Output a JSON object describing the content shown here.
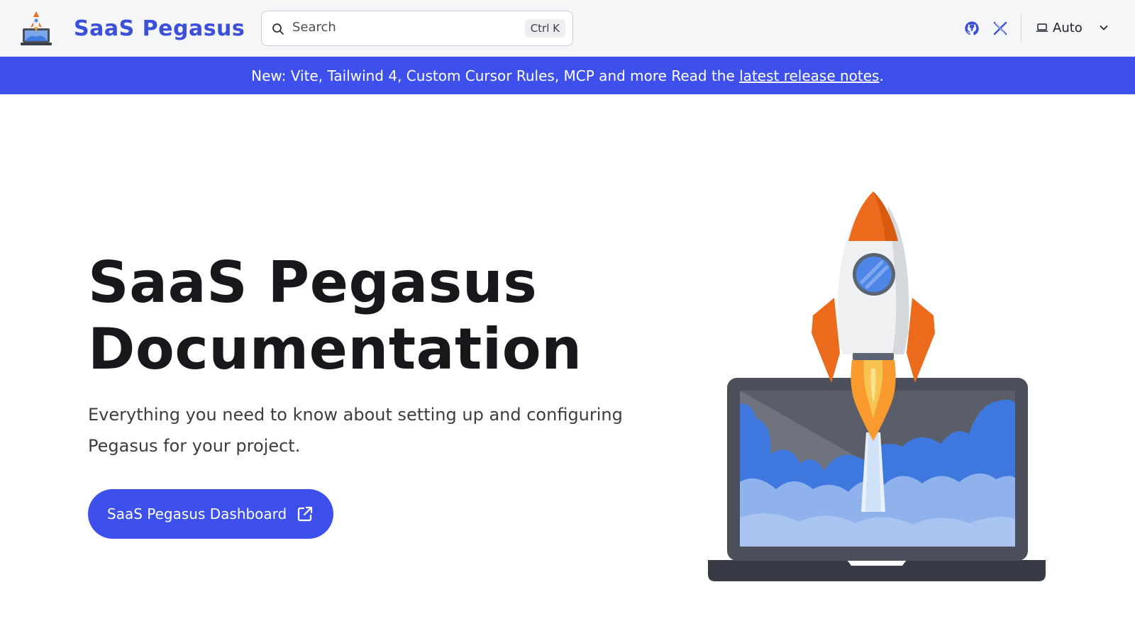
{
  "brand": {
    "title": "SaaS Pegasus",
    "logo_icon": "rocket-laptop-icon"
  },
  "search": {
    "placeholder": "Search",
    "shortcut": "Ctrl K",
    "icon": "search-icon"
  },
  "header_links": {
    "github_icon": "github-icon",
    "x_icon": "x-icon"
  },
  "theme_select": {
    "label": "Auto",
    "icon": "laptop-icon",
    "chevron": "chevron-down-icon"
  },
  "announcement": {
    "text": "New: Vite, Tailwind 4, Custom Cursor Rules, MCP and more Read the ",
    "link": "latest release notes",
    "suffix": "."
  },
  "hero": {
    "title_line1": "SaaS Pegasus",
    "title_line2": "Documentation",
    "subtitle": "Everything you need to know about setting up and configuring Pegasus for your project.",
    "cta_label": "SaaS Pegasus Dashboard",
    "cta_icon": "external-link-icon",
    "illustration": "rocket-launch-laptop-illustration"
  },
  "colors": {
    "accent": "#3d50ec",
    "brand_text": "#3b4fd8",
    "rocket_orange": "#ec6a1c"
  }
}
